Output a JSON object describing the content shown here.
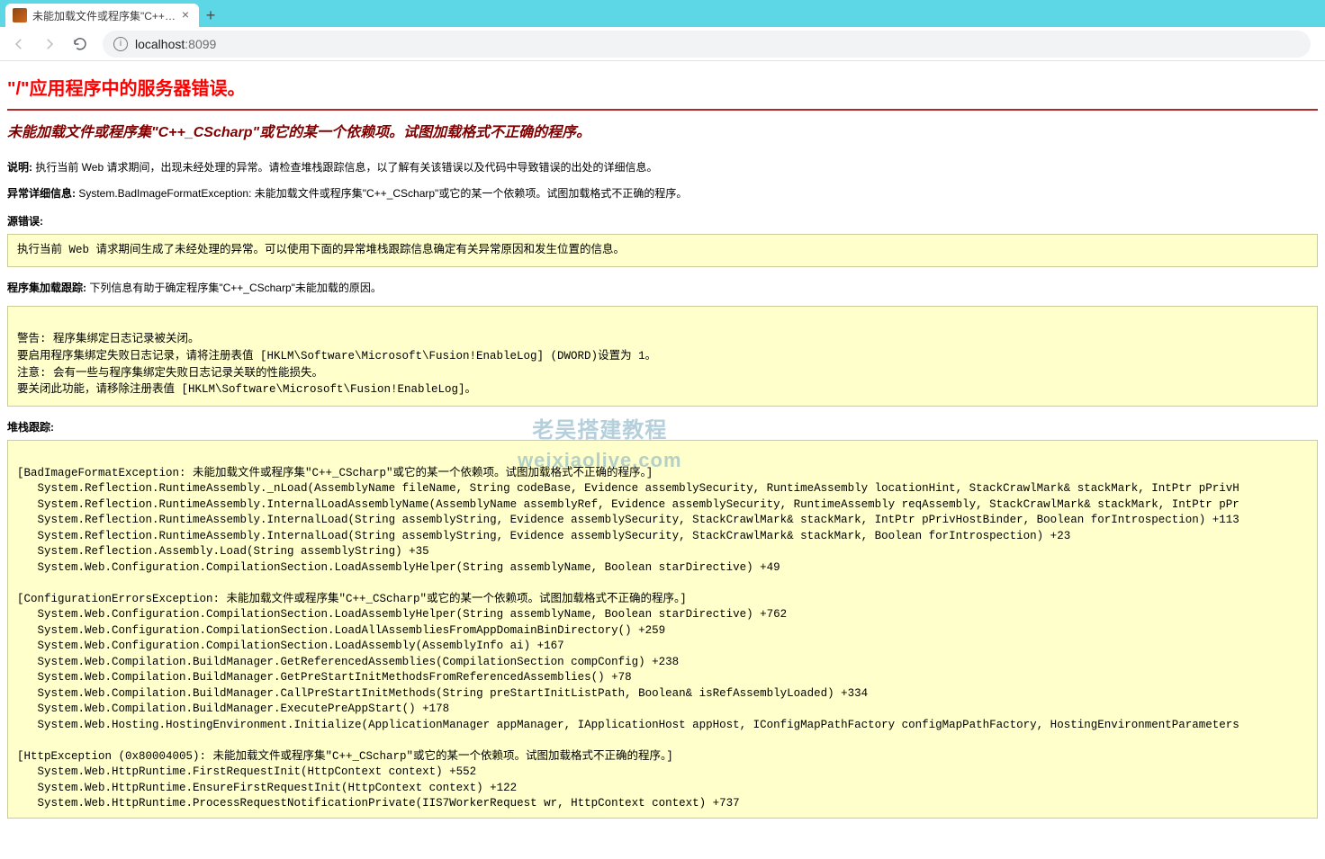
{
  "browser": {
    "tab_title": "未能加载文件或程序集\"C++_CS…",
    "url_host": "localhost",
    "url_port": ":8099",
    "new_tab": "+",
    "close": "×"
  },
  "page": {
    "server_error_heading": "\"/\"应用程序中的服务器错误。",
    "subheading": "未能加载文件或程序集\"C++_CScharp\"或它的某一个依赖项。试图加载格式不正确的程序。",
    "desc_label": "说明:",
    "desc_text": " 执行当前 Web 请求期间，出现未经处理的异常。请检查堆栈跟踪信息，以了解有关该错误以及代码中导致错误的出处的详细信息。",
    "detail_label": "异常详细信息:",
    "detail_text": " System.BadImageFormatException: 未能加载文件或程序集\"C++_CScharp\"或它的某一个依赖项。试图加载格式不正确的程序。",
    "source_label": "源错误:",
    "source_box": "执行当前 Web 请求期间生成了未经处理的异常。可以使用下面的异常堆栈跟踪信息确定有关异常原因和发生位置的信息。",
    "asm_trace_label": "程序集加载跟踪:",
    "asm_trace_text": " 下列信息有助于确定程序集\"C++_CScharp\"未能加载的原因。",
    "asm_box": "\n警告: 程序集绑定日志记录被关闭。\n要启用程序集绑定失败日志记录，请将注册表值 [HKLM\\Software\\Microsoft\\Fusion!EnableLog] (DWORD)设置为 1。\n注意: 会有一些与程序集绑定失败日志记录关联的性能损失。\n要关闭此功能，请移除注册表值 [HKLM\\Software\\Microsoft\\Fusion!EnableLog]。\n",
    "stack_label": "堆栈跟踪:",
    "stack_box": "\n[BadImageFormatException: 未能加载文件或程序集\"C++_CScharp\"或它的某一个依赖项。试图加载格式不正确的程序。]\n   System.Reflection.RuntimeAssembly._nLoad(AssemblyName fileName, String codeBase, Evidence assemblySecurity, RuntimeAssembly locationHint, StackCrawlMark& stackMark, IntPtr pPrivH\n   System.Reflection.RuntimeAssembly.InternalLoadAssemblyName(AssemblyName assemblyRef, Evidence assemblySecurity, RuntimeAssembly reqAssembly, StackCrawlMark& stackMark, IntPtr pPr\n   System.Reflection.RuntimeAssembly.InternalLoad(String assemblyString, Evidence assemblySecurity, StackCrawlMark& stackMark, IntPtr pPrivHostBinder, Boolean forIntrospection) +113\n   System.Reflection.RuntimeAssembly.InternalLoad(String assemblyString, Evidence assemblySecurity, StackCrawlMark& stackMark, Boolean forIntrospection) +23\n   System.Reflection.Assembly.Load(String assemblyString) +35\n   System.Web.Configuration.CompilationSection.LoadAssemblyHelper(String assemblyName, Boolean starDirective) +49\n\n[ConfigurationErrorsException: 未能加载文件或程序集\"C++_CScharp\"或它的某一个依赖项。试图加载格式不正确的程序。]\n   System.Web.Configuration.CompilationSection.LoadAssemblyHelper(String assemblyName, Boolean starDirective) +762\n   System.Web.Configuration.CompilationSection.LoadAllAssembliesFromAppDomainBinDirectory() +259\n   System.Web.Configuration.CompilationSection.LoadAssembly(AssemblyInfo ai) +167\n   System.Web.Compilation.BuildManager.GetReferencedAssemblies(CompilationSection compConfig) +238\n   System.Web.Compilation.BuildManager.GetPreStartInitMethodsFromReferencedAssemblies() +78\n   System.Web.Compilation.BuildManager.CallPreStartInitMethods(String preStartInitListPath, Boolean& isRefAssemblyLoaded) +334\n   System.Web.Compilation.BuildManager.ExecutePreAppStart() +178\n   System.Web.Hosting.HostingEnvironment.Initialize(ApplicationManager appManager, IApplicationHost appHost, IConfigMapPathFactory configMapPathFactory, HostingEnvironmentParameters\n\n[HttpException (0x80004005): 未能加载文件或程序集\"C++_CScharp\"或它的某一个依赖项。试图加载格式不正确的程序。]\n   System.Web.HttpRuntime.FirstRequestInit(HttpContext context) +552\n   System.Web.HttpRuntime.EnsureFirstRequestInit(HttpContext context) +122\n   System.Web.HttpRuntime.ProcessRequestNotificationPrivate(IIS7WorkerRequest wr, HttpContext context) +737"
  },
  "watermark": {
    "line1": "老吴搭建教程",
    "line2": "weixiaolive.com"
  }
}
